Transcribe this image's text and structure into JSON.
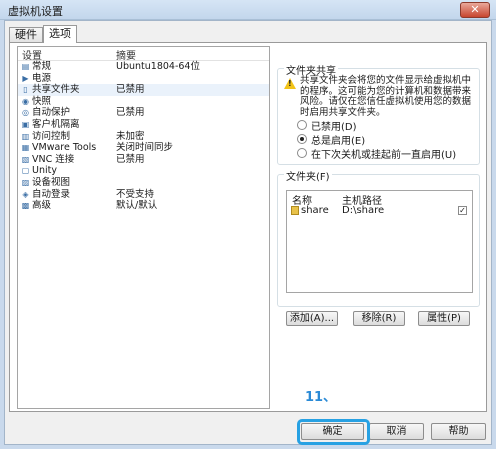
{
  "window": {
    "title": "虚拟机设置",
    "close_glyph": "✕"
  },
  "tabs": [
    {
      "label": "硬件",
      "active": false
    },
    {
      "label": "选项",
      "active": true
    }
  ],
  "settings": {
    "col_setting": "设置",
    "col_summary": "摘要",
    "rows": [
      {
        "icon": "general-icon",
        "glyph": "▤",
        "name": "常规",
        "value": "Ubuntu1804-64位"
      },
      {
        "icon": "power-icon",
        "glyph": "▶",
        "name": "电源",
        "value": ""
      },
      {
        "icon": "shared-folder-icon",
        "glyph": "▯",
        "name": "共享文件夹",
        "value": "已禁用"
      },
      {
        "icon": "snapshot-icon",
        "glyph": "◉",
        "name": "快照",
        "value": ""
      },
      {
        "icon": "autoprotect-icon",
        "glyph": "◎",
        "name": "自动保护",
        "value": "已禁用"
      },
      {
        "icon": "isolation-icon",
        "glyph": "▣",
        "name": "客户机隔离",
        "value": ""
      },
      {
        "icon": "access-control-icon",
        "glyph": "▥",
        "name": "访问控制",
        "value": "未加密"
      },
      {
        "icon": "vmware-tools-icon",
        "glyph": "▦",
        "name": "VMware Tools",
        "value": "关闭时间同步"
      },
      {
        "icon": "vnc-icon",
        "glyph": "▧",
        "name": "VNC 连接",
        "value": "已禁用"
      },
      {
        "icon": "unity-icon",
        "glyph": "▢",
        "name": "Unity",
        "value": ""
      },
      {
        "icon": "device-view-icon",
        "glyph": "▨",
        "name": "设备视图",
        "value": ""
      },
      {
        "icon": "autologin-icon",
        "glyph": "◈",
        "name": "自动登录",
        "value": "不受支持"
      },
      {
        "icon": "advanced-icon",
        "glyph": "▩",
        "name": "高级",
        "value": "默认/默认"
      }
    ]
  },
  "folder_sharing": {
    "title": "文件夹共享",
    "warning": "共享文件夹会将您的文件显示给虚拟机中的程序。这可能为您的计算机和数据带来风险。请仅在您信任虚拟机使用您的数据时启用共享文件夹。",
    "options": [
      {
        "label": "已禁用(D)",
        "checked": false
      },
      {
        "label": "总是启用(E)",
        "checked": true
      },
      {
        "label": "在下次关机或挂起前一直启用(U)",
        "checked": false
      }
    ]
  },
  "folders": {
    "title": "文件夹(F)",
    "col_name": "名称",
    "col_path": "主机路径",
    "rows": [
      {
        "name": "share",
        "path": "D:\\share",
        "checked": true
      }
    ],
    "check_glyph": "✓",
    "add_label": "添加(A)...",
    "remove_label": "移除(R)",
    "props_label": "属性(P)"
  },
  "footer": {
    "ok_label": "确定",
    "cancel_label": "取消",
    "help_label": "帮助"
  },
  "annotation": {
    "step": "11、"
  }
}
